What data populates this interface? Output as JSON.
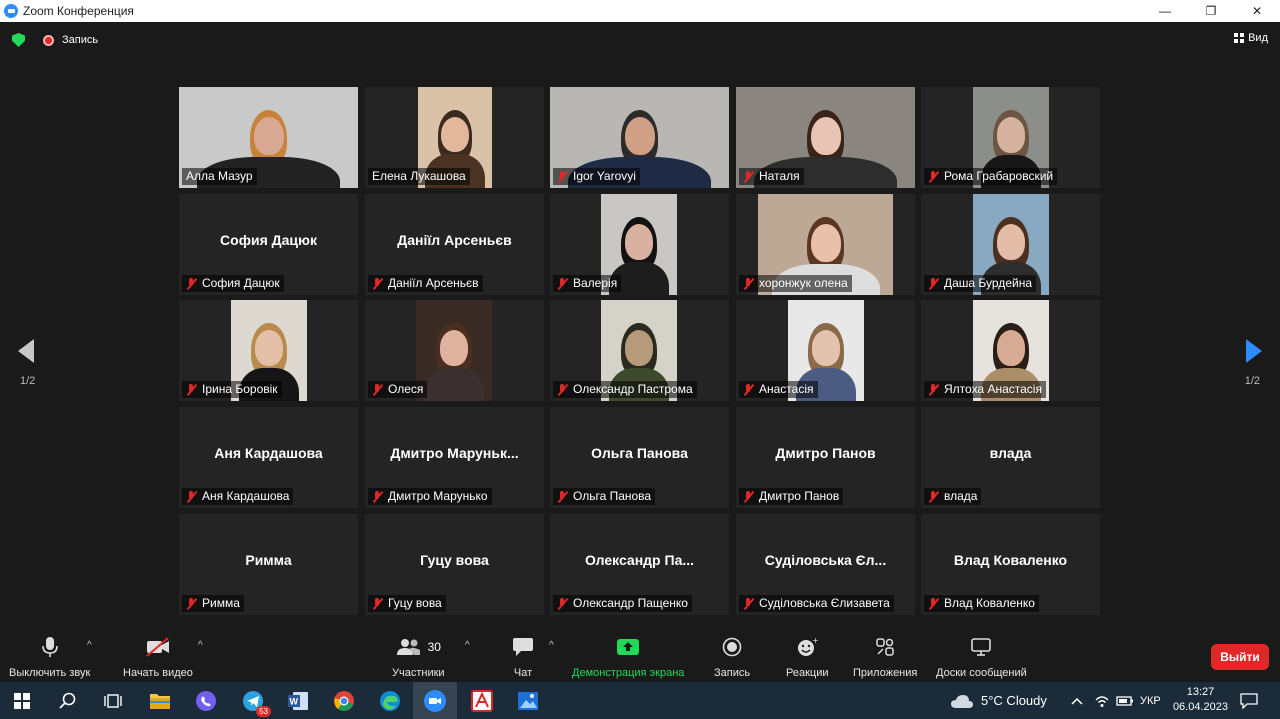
{
  "window": {
    "title": "Zoom Конференция",
    "controls": [
      "—",
      "❐",
      "✕"
    ]
  },
  "topbar": {
    "record_label": "Запись",
    "view_label": "Вид"
  },
  "page": {
    "left": "1/2",
    "right": "1/2"
  },
  "tiles": [
    {
      "name": "Алла Мазур",
      "video": true,
      "muted": false,
      "active": true
    },
    {
      "name": "Елена Лукашова",
      "video": true,
      "muted": false
    },
    {
      "name": "Igor Yarovyi",
      "video": true,
      "muted": true
    },
    {
      "name": "Наталя",
      "video": true,
      "muted": true
    },
    {
      "name": "Рома Грабаровский",
      "video": true,
      "muted": true
    },
    {
      "name": "София Дацюк",
      "center": "София Дацюк",
      "video": false,
      "muted": true
    },
    {
      "name": "Даніїл Арсеньєв",
      "center": "Даніїл Арсеньєв",
      "video": false,
      "muted": true
    },
    {
      "name": "Валерія",
      "video": true,
      "muted": true
    },
    {
      "name": "хоронжук олена",
      "video": true,
      "muted": true
    },
    {
      "name": "Даша Бурдейна",
      "video": true,
      "muted": true
    },
    {
      "name": "Ірина Боровік",
      "video": true,
      "muted": true
    },
    {
      "name": "Олеся",
      "video": true,
      "muted": true
    },
    {
      "name": "Олександр Пастрома",
      "video": true,
      "muted": true
    },
    {
      "name": "Анастасія",
      "video": true,
      "muted": true
    },
    {
      "name": "Ялтоха Анастасія",
      "video": true,
      "muted": true
    },
    {
      "name": "Аня Кардашова",
      "center": "Аня Кардашова",
      "video": false,
      "muted": true
    },
    {
      "name": "Дмитро Марунько",
      "center": "Дмитро  Маруньк...",
      "video": false,
      "muted": true
    },
    {
      "name": "Ольга Панова",
      "center": "Ольга Панова",
      "video": false,
      "muted": true
    },
    {
      "name": "Дмитро Панов",
      "center": "Дмитро Панов",
      "video": false,
      "muted": true
    },
    {
      "name": "влада",
      "center": "влада",
      "video": false,
      "muted": true
    },
    {
      "name": "Римма",
      "center": "Римма",
      "video": false,
      "muted": true
    },
    {
      "name": "Гуцу вова",
      "center": "Гуцу вова",
      "video": false,
      "muted": true
    },
    {
      "name": "Олександр Пащенко",
      "center": "Олександр  Па...",
      "video": false,
      "muted": true
    },
    {
      "name": "Суділовська Єлизавета",
      "center": "Суділовська Єл...",
      "video": false,
      "muted": true
    },
    {
      "name": "Влад Коваленко",
      "center": "Влад Коваленко",
      "video": false,
      "muted": true
    }
  ],
  "toolbar": {
    "mute": "Выключить звук",
    "video": "Начать видео",
    "participants": "Участники",
    "participants_count": "30",
    "chat": "Чат",
    "share": "Демонстрация экрана",
    "record": "Запись",
    "reactions": "Реакции",
    "apps": "Приложения",
    "whiteboards": "Доски сообщений",
    "leave": "Выйти"
  },
  "taskbar": {
    "telegram_badge": "53",
    "weather": "5°C  Cloudy",
    "language": "УКР",
    "time": "13:27",
    "date": "06.04.2023"
  },
  "colors": {
    "accent": "#2d8cff",
    "active_speaker": "#b9e34c",
    "muted": "#e02828",
    "share": "#23d959",
    "leave": "#e02828"
  }
}
